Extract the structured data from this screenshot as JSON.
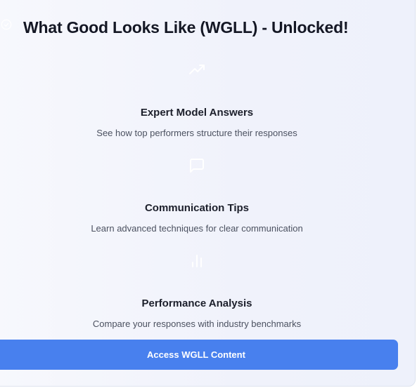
{
  "header": {
    "title": "What Good Looks Like (WGLL) - Unlocked!",
    "icon": "check-circle-icon"
  },
  "features": [
    {
      "icon": "trending-up-icon",
      "title": "Expert Model Answers",
      "description": "See how top performers structure their responses"
    },
    {
      "icon": "message-square-icon",
      "title": "Communication Tips",
      "description": "Learn advanced techniques for clear communication"
    },
    {
      "icon": "bar-chart-icon",
      "title": "Performance Analysis",
      "description": "Compare your responses with industry benchmarks"
    }
  ],
  "cta": {
    "label": "Access WGLL Content"
  },
  "colors": {
    "accent": "#4880ee",
    "icon": "#ffffff"
  }
}
